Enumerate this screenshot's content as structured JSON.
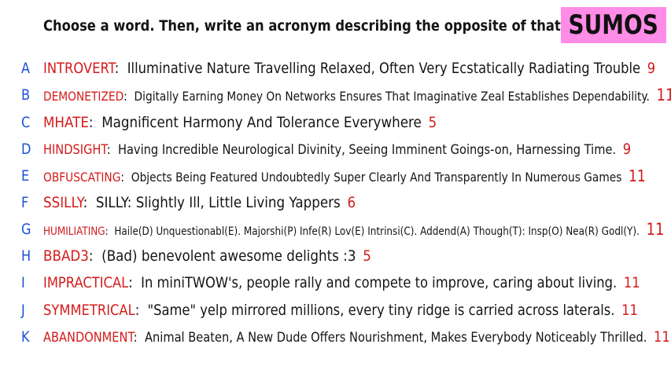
{
  "prompt": "Choose a word. Then, write an acronym describing the opposite of that word!",
  "badge": "SUMOS",
  "entries": [
    {
      "letter": "A",
      "word": "INTROVERT",
      "acronym": "Illuminative Nature Travelling Relaxed, Often Very Ecstatically Radiating Trouble",
      "count": "9"
    },
    {
      "letter": "B",
      "word": "DEMONETIZED",
      "acronym": "Digitally Earning Money On Networks Ensures That Imaginative Zeal Establishes Dependability.",
      "count": "11"
    },
    {
      "letter": "C",
      "word": "MHATE",
      "acronym": "Magnificent  Harmony And Tolerance Everywhere",
      "count": "5"
    },
    {
      "letter": "D",
      "word": "HINDSIGHT",
      "acronym": "Having Incredible Neurological Divinity, Seeing Imminent Goings-on, Harnessing Time.",
      "count": "9"
    },
    {
      "letter": "E",
      "word": "OBFUSCATING",
      "acronym": "Objects Being Featured Undoubtedly Super Clearly And Transparently In Numerous Games",
      "count": "11"
    },
    {
      "letter": "F",
      "word": "SSILLY",
      "acronym": "SILLY: Slightly Ill, Little Living Yappers",
      "count": "6"
    },
    {
      "letter": "G",
      "word": "HUMILIATING",
      "acronym": "Haile(D) Unquestionabl(E). Majorshi(P) Infe(R) Lov(E) Intrinsi(C). Addend(A) Though(T): Insp(O) Nea(R) Godl(Y).",
      "count": "11"
    },
    {
      "letter": "H",
      "word": "BBAD3",
      "acronym": "(Bad) benevolent awesome delights :3",
      "count": "5"
    },
    {
      "letter": "I",
      "word": "IMPRACTICAL",
      "acronym": "In miniTWOW's, people rally and compete to improve, caring about living.",
      "count": "11"
    },
    {
      "letter": "J",
      "word": "SYMMETRICAL",
      "acronym": "\"Same\" yelp mirrored millions, every tiny ridge is carried across laterals.",
      "count": "11"
    },
    {
      "letter": "K",
      "word": "ABANDONMENT",
      "acronym": "Animal Beaten, A New Dude Offers Nourishment, Makes Everybody Noticeably Thrilled.",
      "count": "11"
    }
  ]
}
